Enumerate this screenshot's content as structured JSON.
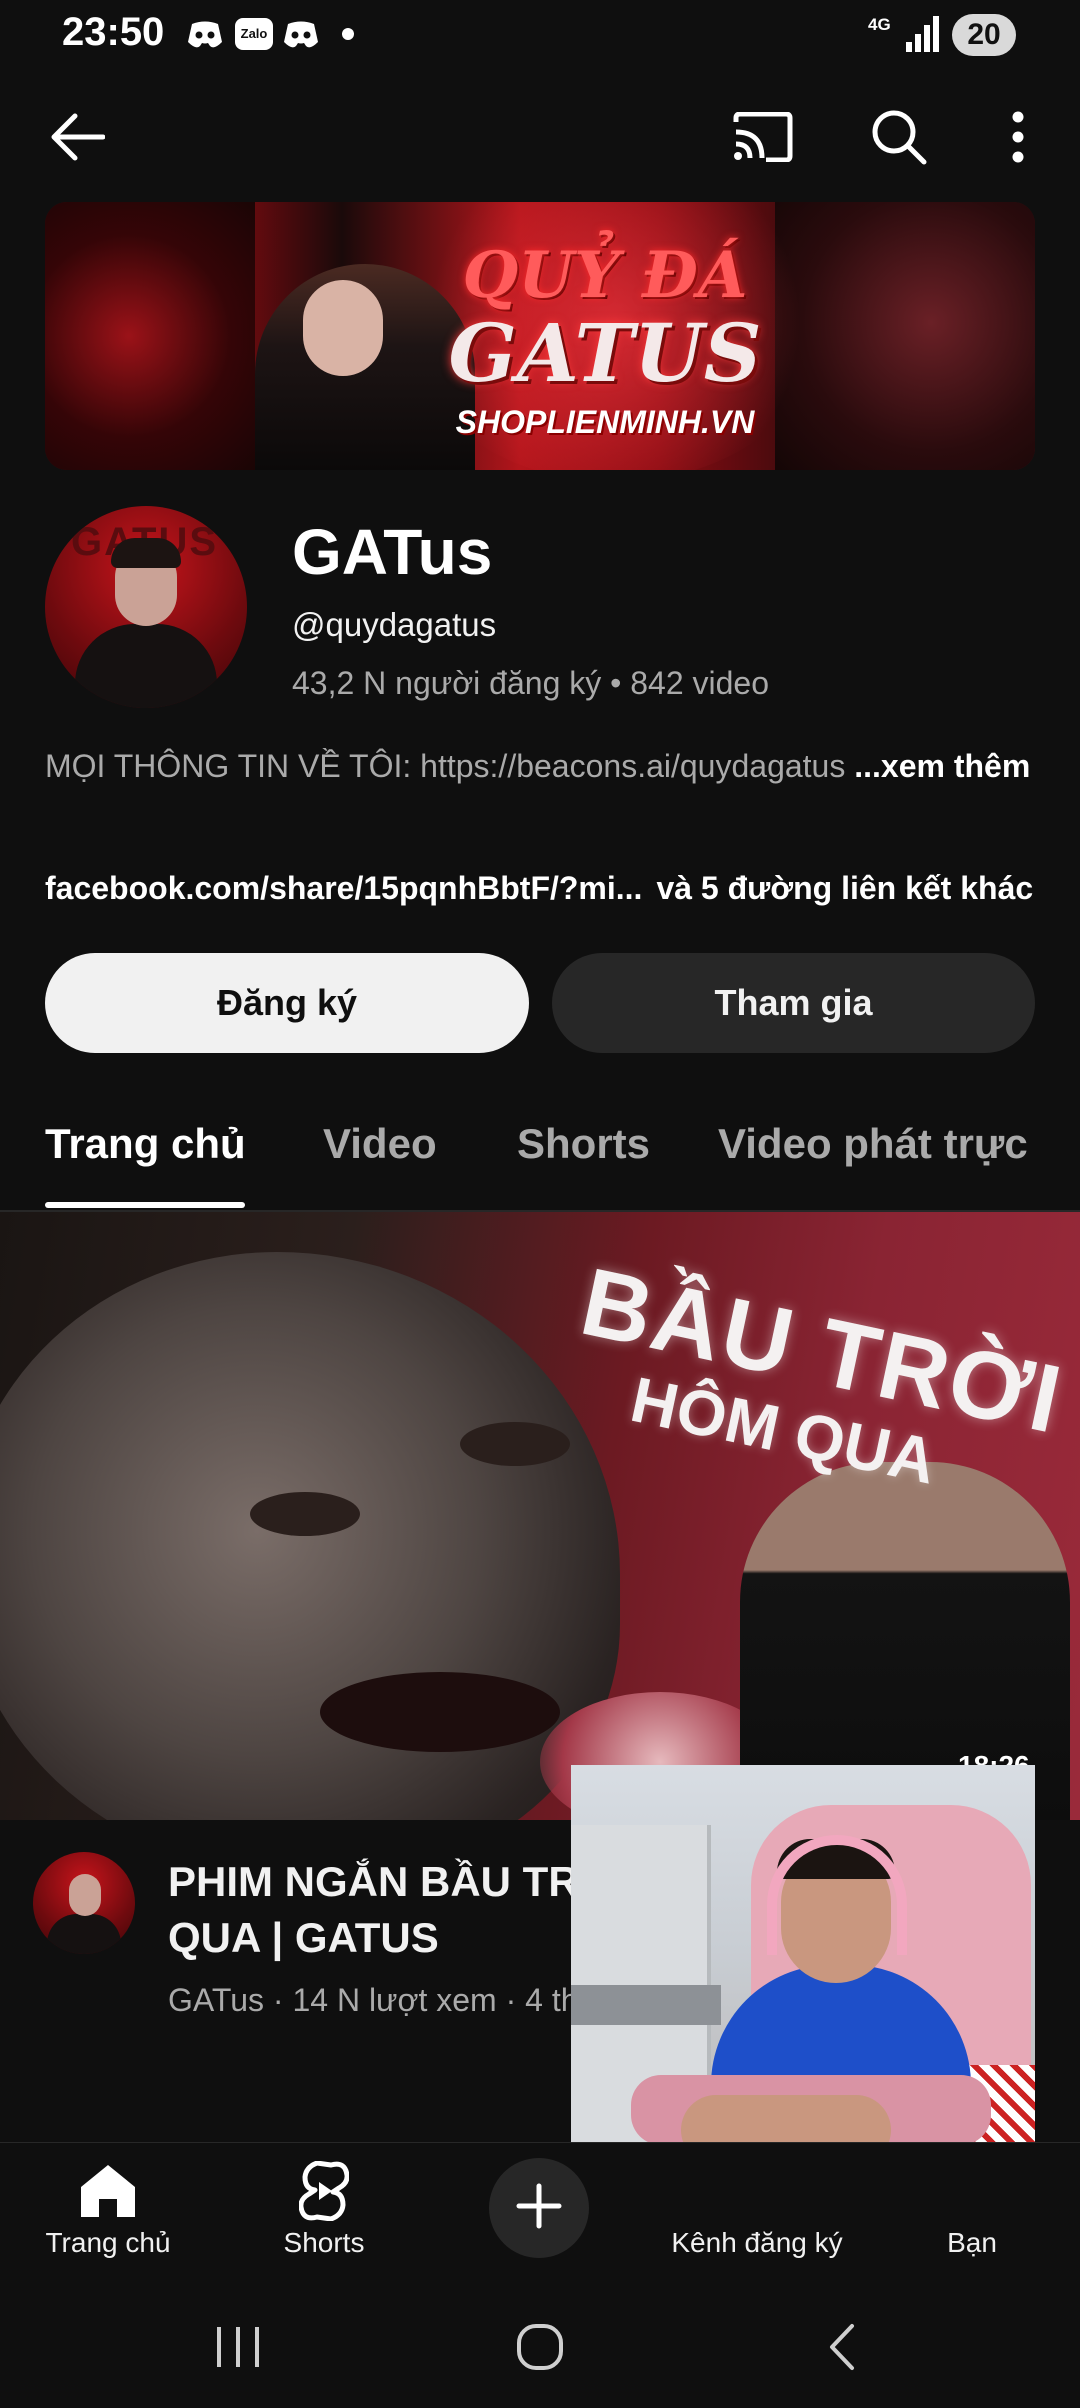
{
  "status_bar": {
    "time": "23:50",
    "apps": [
      "discord-icon",
      "Zalo",
      "discord-icon"
    ],
    "zalo_label": "Zalo",
    "network": "4G",
    "battery": "20"
  },
  "top_bar": {
    "icons": [
      "back-arrow-icon",
      "cast-icon",
      "search-icon",
      "more-vert-icon"
    ]
  },
  "banner": {
    "line1": "QUỶ ĐÁ",
    "line2": "GATUS",
    "line3": "SHOPLIENMINH.VN"
  },
  "channel": {
    "avatar_text": "GATUS",
    "name": "GATus",
    "handle": "@quydagatus",
    "stats": "43,2 N người đăng ký • 842 video",
    "description": "MỌI THÔNG TIN VỀ TÔI: https://beacons.ai/quydagatus",
    "description_more": " ...xem thêm",
    "link": "facebook.com/share/15pqnhBbtF/?mi...",
    "link_extra": "và 5 đường liên kết khác",
    "subscribe_label": "Đăng ký",
    "join_label": "Tham gia"
  },
  "tabs": [
    {
      "label": "Trang chủ",
      "active": true
    },
    {
      "label": "Video",
      "active": false
    },
    {
      "label": "Shorts",
      "active": false
    },
    {
      "label": "Video phát trực",
      "active": false
    }
  ],
  "featured_video": {
    "thumbnail_title_line1": "BẦU TRỜI",
    "thumbnail_title_line2": "HÔM QUA",
    "duration": "18:26",
    "title": "PHIM NGẮN BẦU TRỜI HÔM QUA | GATUS",
    "title_visible": "PHIM NGẮN BẦU TR GATUS",
    "meta": "GATus · 14 N lượt xem · 4 tháng trước"
  },
  "bottom_nav": {
    "items": [
      {
        "label": "Trang chủ",
        "icon": "home-icon"
      },
      {
        "label": "Shorts",
        "icon": "shorts-icon"
      },
      {
        "label": "",
        "icon": "create-plus-icon"
      },
      {
        "label": "Kênh đăng ký",
        "icon": "subscriptions-icon"
      },
      {
        "label": "Bạn",
        "icon": "you-icon"
      }
    ]
  },
  "system_nav": {
    "icons": [
      "recent-apps-icon",
      "home-circle-icon",
      "back-chevron-icon"
    ]
  },
  "colors": {
    "background": "#0f0f0f",
    "surface": "#272727",
    "text_primary": "#f1f1f1",
    "text_secondary": "#aaaaaa"
  }
}
